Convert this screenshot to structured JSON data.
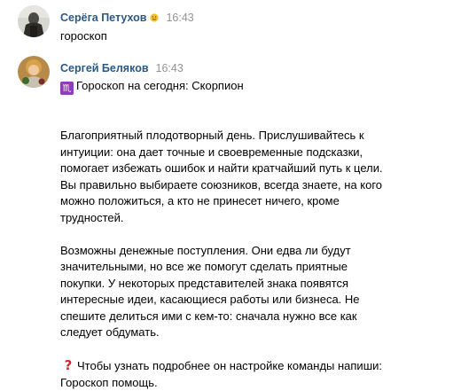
{
  "messages": [
    {
      "author": "Серёга Петухов",
      "author_emoji": "smiley-emoji",
      "time": "16:43",
      "text": "гороскоп"
    },
    {
      "author": "Сергей Беляков",
      "time": "16:43",
      "header_icon": "scorpio-zodiac-icon",
      "header_text": "Гороскоп на сегодня: Скорпион",
      "para1": [
        "Благоприятный плодотворный день. Прислушивайтесь к",
        "интуиции: она дает точные и своевременные подсказки,",
        "помогает избежать ошибок и найти кратчайший путь к цели.",
        "Вы правильно выбираете союзников, всегда знаете, на кого",
        "можно положиться, а кто не принесет ничего, кроме",
        "трудностей."
      ],
      "para2": [
        "Возможны денежные поступления. Они едва ли будут",
        "значительными, но все же помогут сделать приятные",
        "покупки. У некоторых представителей знака появятся",
        "интересные идеи, касающиеся работы или бизнеса. Не",
        "спешите делиться ими с кем-то: сначала нужно все как",
        "следует обдумать."
      ],
      "footer_icon": "red-question-mark-icon",
      "footer_line1": "Чтобы узнать подробнее он настройке команды напиши:",
      "footer_line2": "Гороскоп помощь."
    }
  ],
  "colors": {
    "author_link": "#2a5885",
    "timestamp": "#939393",
    "scorpio_badge": "#8e3fb8",
    "question_mark": "#d9262c"
  }
}
